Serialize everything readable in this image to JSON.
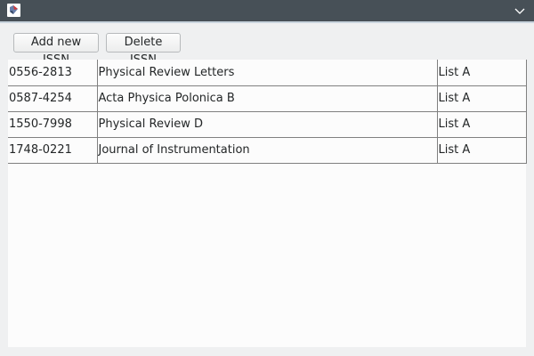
{
  "window": {
    "icon": "java-app-icon",
    "collapse_icon": "chevron-down-icon"
  },
  "toolbar": {
    "add_label": "Add new ISSN",
    "delete_label": "Delete ISSN"
  },
  "table": {
    "rows": [
      [
        "0556-2813",
        "Physical Review Letters",
        "List A"
      ],
      [
        "0587-4254",
        "Acta Physica Polonica B",
        "List A"
      ],
      [
        "1550-7998",
        "Physical Review D",
        "List A"
      ],
      [
        "1748-0221",
        "Journal of Instrumentation",
        "List A"
      ]
    ]
  }
}
